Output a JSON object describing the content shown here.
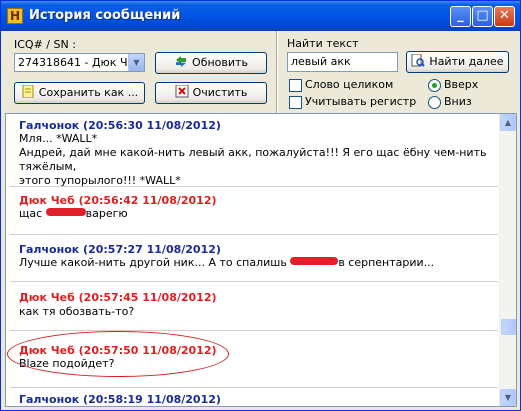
{
  "window": {
    "title": "История сообщений",
    "app_icon_letter": "H"
  },
  "controls": {
    "icq_label": "ICQ# / SN :",
    "contact_selected": "274318641 - Дюк Чеб",
    "refresh_label": "Обновить",
    "save_label": "Сохранить как ...",
    "clear_label": "Очистить",
    "search_label": "Найти текст",
    "search_value": "левый акк",
    "find_next_label": "Найти далее",
    "whole_word_label": "Слово целиком",
    "whole_word_checked": false,
    "match_case_label": "Учитывать регистр",
    "match_case_checked": false,
    "dir_up_label": "Вверх",
    "dir_up_selected": true,
    "dir_down_label": "Вниз",
    "dir_down_selected": false
  },
  "colors": {
    "incoming": "#1a2a9a",
    "outgoing": "#e02020",
    "highlight_ellipse": "#d22020"
  },
  "messages": [
    {
      "header": "Галчонок (20:56:30 11/08/2012)",
      "color": "#1a2a9a",
      "lines": [
        "Мля... *WALL*",
        "Андрей, дай мне какой-нить левый акк, пожалуйста!!! Я его щас ёбну чем-нить тяжёлым,",
        "этого тупорылого!!! *WALL*"
      ]
    },
    {
      "header": "Дюк Чеб (20:56:42 11/08/2012)",
      "color": "#e02020",
      "text_before": "щас ",
      "text_after": "варегю"
    },
    {
      "header": "Галчонок (20:57:27 11/08/2012)",
      "color": "#1a2a9a",
      "text_before": "Лучше какой-нить другой ник... А то спалишь ",
      "text_after": "в серпентарии..."
    },
    {
      "header": "Дюк Чеб (20:57:45 11/08/2012)",
      "color": "#e02020",
      "lines": [
        "как тя обозвать-то?"
      ]
    },
    {
      "header": "Дюк Чеб (20:57:50 11/08/2012)",
      "color": "#e02020",
      "lines": [
        "Blaze подойдет?"
      ]
    },
    {
      "header": "Галчонок (20:58:19 11/08/2012)",
      "color": "#1a2a9a",
      "lines": []
    }
  ]
}
